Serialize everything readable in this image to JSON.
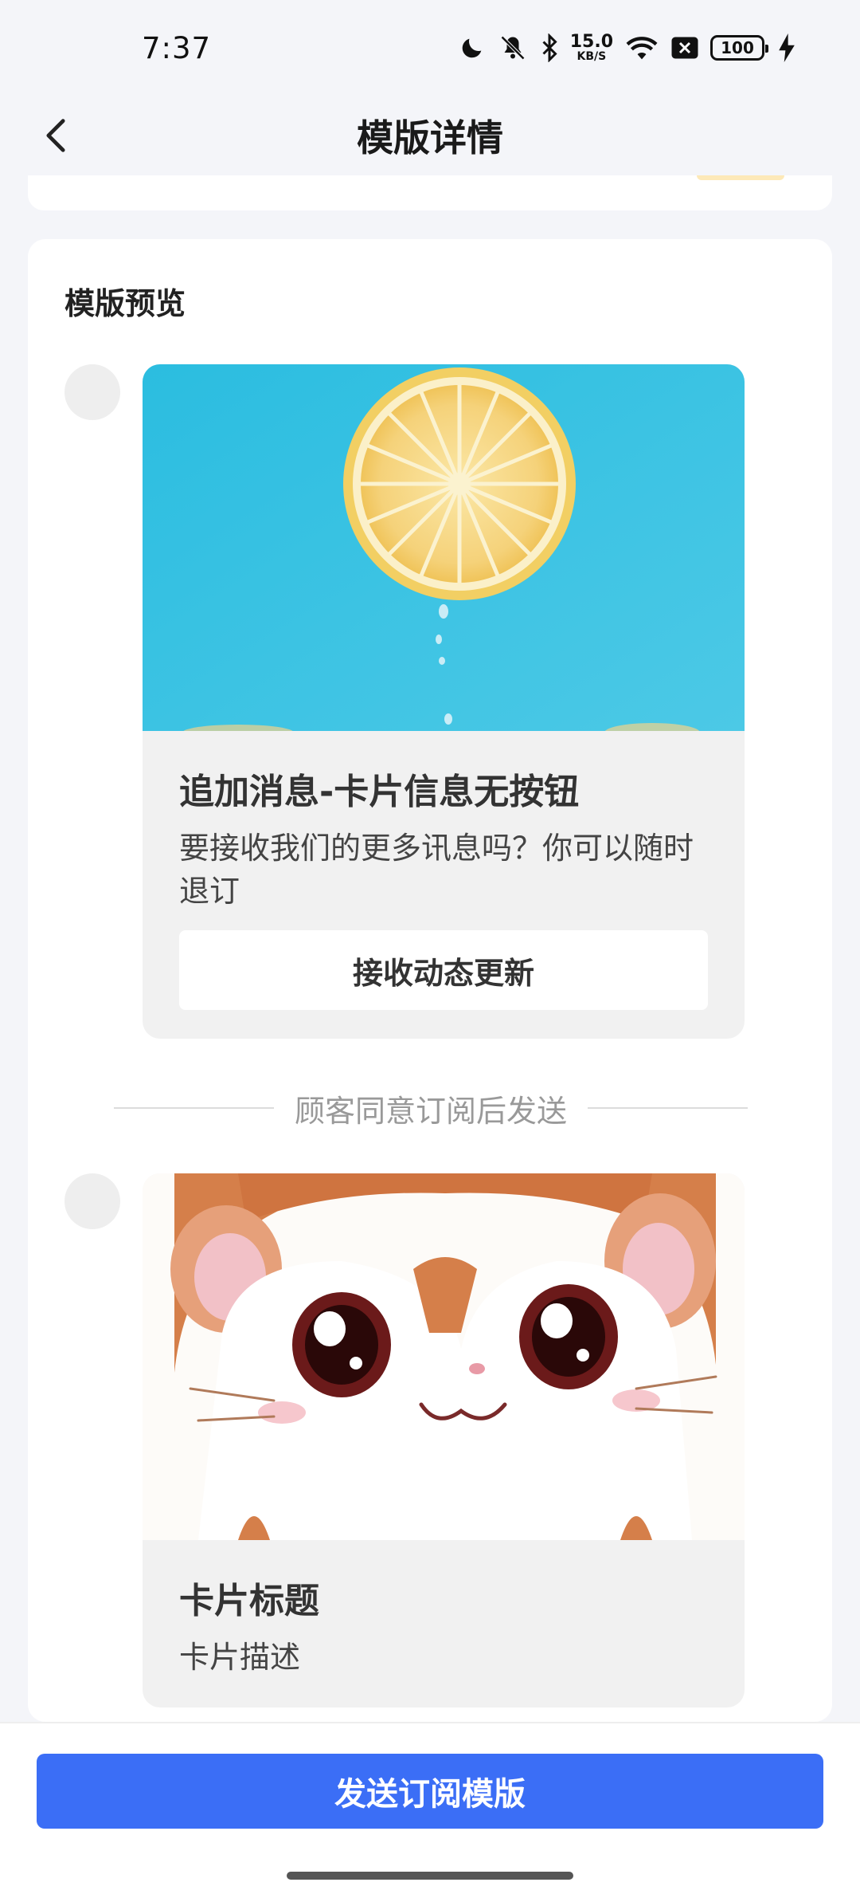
{
  "status_bar": {
    "time": "7:37",
    "net_speed_value": "15.0",
    "net_speed_unit": "KB/S",
    "battery_level": "100",
    "icons": [
      "moon-icon",
      "mute-icon",
      "bluetooth-icon",
      "wifi-icon",
      "sim-off-icon",
      "battery-icon",
      "charging-icon"
    ]
  },
  "header": {
    "title": "模版详情",
    "back_icon": "chevron-left-icon"
  },
  "preview": {
    "section_title": "模版预览",
    "messages": [
      {
        "image": "lemon-slice-photo",
        "title": "追加消息-卡片信息无按钮",
        "description": "要接收我们的更多讯息吗？你可以随时退订",
        "button_label": "接收动态更新"
      },
      {
        "image": "hamster-cartoon",
        "title": "卡片标题",
        "description": "卡片描述"
      }
    ],
    "divider_text": "顾客同意订阅后发送"
  },
  "footer": {
    "send_button_label": "发送订阅模版",
    "accent_color": "#3b6ef6"
  }
}
